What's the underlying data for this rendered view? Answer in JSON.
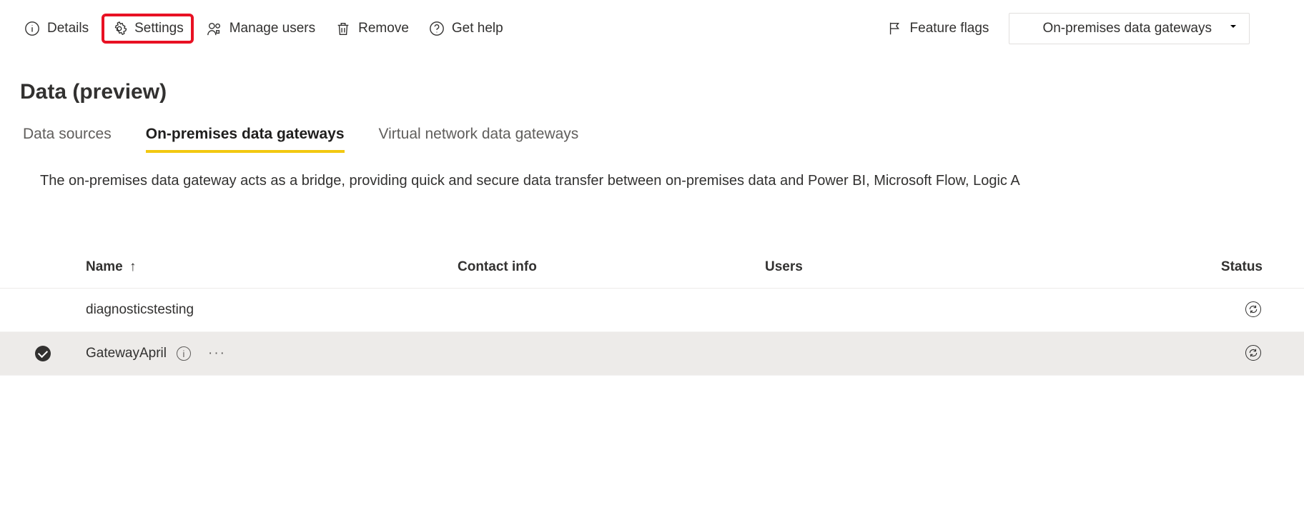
{
  "toolbar": {
    "details_label": "Details",
    "settings_label": "Settings",
    "manage_users_label": "Manage users",
    "remove_label": "Remove",
    "get_help_label": "Get help",
    "feature_flags_label": "Feature flags",
    "filter_label": "On-premises data gateways"
  },
  "page": {
    "title": "Data (preview)",
    "description": "The on-premises data gateway acts as a bridge, providing quick and secure data transfer between on-premises data and Power BI, Microsoft Flow, Logic A"
  },
  "tabs": [
    {
      "label": "Data sources",
      "active": false
    },
    {
      "label": "On-premises data gateways",
      "active": true
    },
    {
      "label": "Virtual network data gateways",
      "active": false
    }
  ],
  "table": {
    "columns": {
      "name": "Name",
      "contact": "Contact info",
      "users": "Users",
      "status": "Status"
    },
    "sort": {
      "column": "name",
      "dir": "asc",
      "arrow": "↑"
    },
    "rows": [
      {
        "selected": false,
        "name": "diagnosticstesting",
        "contact": "",
        "users": "",
        "status_icon": "refresh"
      },
      {
        "selected": true,
        "name": "GatewayApril",
        "contact": "",
        "users": "",
        "status_icon": "refresh"
      }
    ]
  }
}
